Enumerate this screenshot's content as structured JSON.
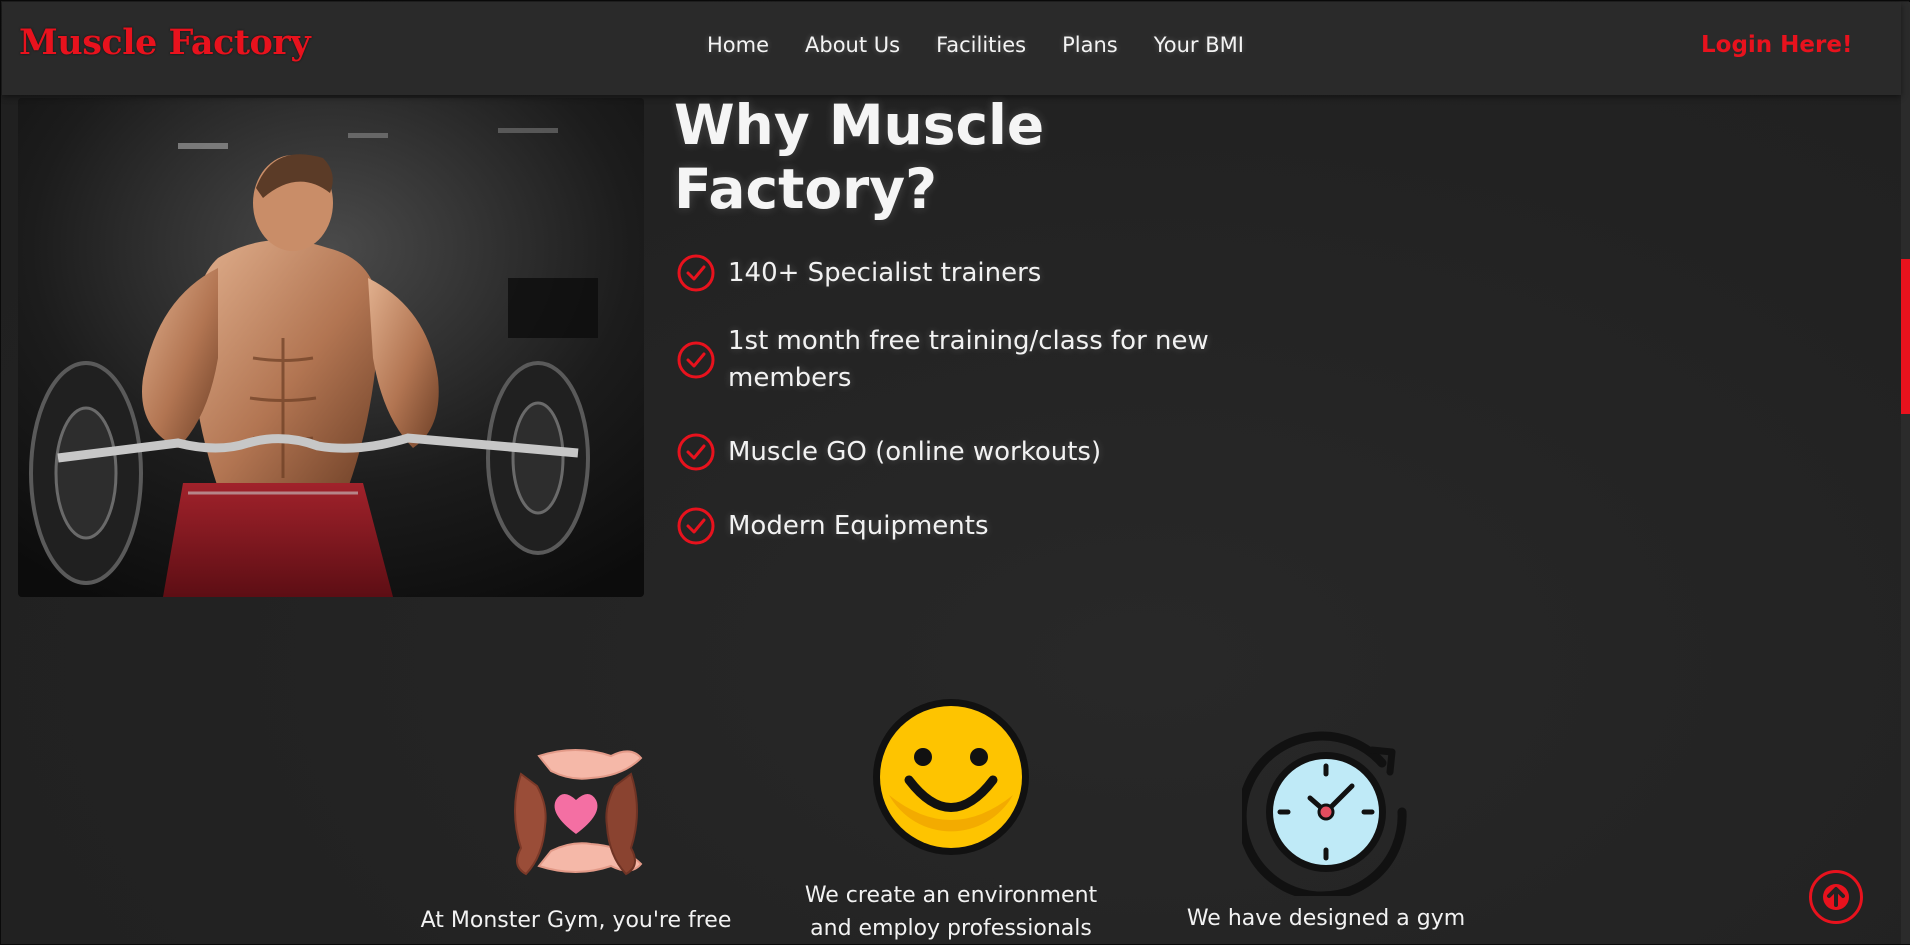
{
  "navbar": {
    "logo": "Muscle Factory",
    "links": [
      "Home",
      "About Us",
      "Facilities",
      "Plans",
      "Your BMI"
    ],
    "login": "Login Here!"
  },
  "why": {
    "title_line1": "Why Muscle",
    "title_line2": "Factory?",
    "features": [
      "140+ Specialist trainers",
      "1st month free training/class for new",
      "members",
      "Muscle GO (online workouts)",
      "Modern Equipments"
    ]
  },
  "cards": [
    {
      "icon": "caring-hands-heart-icon",
      "text_line1": "At Monster Gym, you're free"
    },
    {
      "icon": "smiley-face-icon",
      "text_line1": "We create an environment",
      "text_line2": "and employ professionals"
    },
    {
      "icon": "clock-icon",
      "text_line1": "We have designed a gym"
    }
  ],
  "colors": {
    "accent": "#e8121d",
    "background": "#232323",
    "navbar": "#2a2a2a"
  },
  "icons": {
    "check": "check-circle-icon",
    "back_to_top": "arrow-up-circle-icon"
  }
}
